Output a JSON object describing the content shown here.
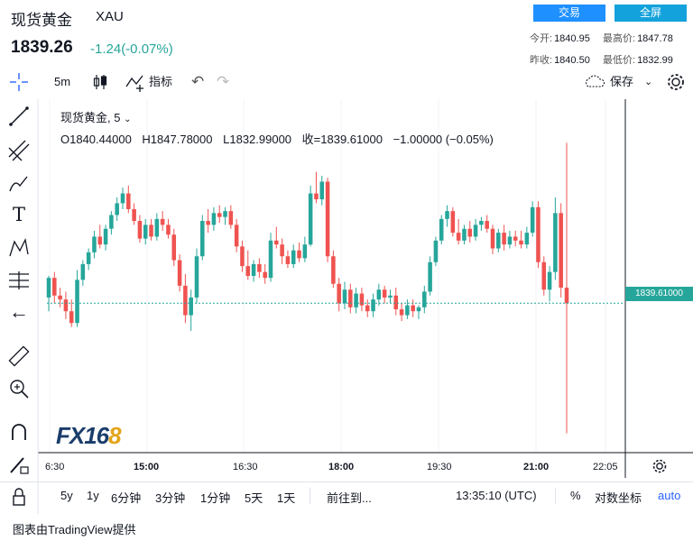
{
  "header": {
    "name": "现货黄金",
    "code": "XAU",
    "price": "1839.26",
    "change": "-1.24(-0.07%)",
    "buttons": {
      "trade": "交易",
      "fullscreen": "全屏"
    },
    "stats": {
      "open_label": "今开:",
      "open": "1840.95",
      "high_label": "最高价:",
      "high": "1847.78",
      "prev_label": "昨收:",
      "prev": "1840.50",
      "low_label": "最低价:",
      "low": "1832.99"
    }
  },
  "toolbar": {
    "interval": "5m",
    "indicators": "指标",
    "save": "保存"
  },
  "legend": {
    "title": "现货黄金, 5",
    "open": "O1840.44000",
    "high": "H1847.78000",
    "low": "L1832.99000",
    "close": "收=1839.61000",
    "change": "−1.00000 (−0.05%)"
  },
  "price_tag": "1839.61000",
  "watermark": "FX168",
  "time_axis": [
    "6:30",
    "15:00",
    "16:30",
    "18:00",
    "19:30",
    "21:00",
    "22:05"
  ],
  "bottom": {
    "ranges": [
      "5y",
      "1y",
      "6分钟",
      "3分钟",
      "1分钟",
      "5天",
      "1天"
    ],
    "goto": "前往到...",
    "clock": "13:35:10 (UTC)",
    "percent": "%",
    "log": "对数坐标",
    "auto": "auto"
  },
  "credit": "图表由TradingView提供",
  "colors": {
    "up": "#26a69a",
    "down": "#ef5350",
    "accent": "#1e90ff"
  },
  "chart_data": {
    "type": "candlestick",
    "y_last": 1839.61,
    "candles": [
      [
        1839.9,
        1841.0,
        1839.2,
        1840.9
      ],
      [
        1840.9,
        1841.2,
        1839.6,
        1840.0
      ],
      [
        1840.0,
        1840.4,
        1839.4,
        1839.8
      ],
      [
        1839.8,
        1840.2,
        1838.8,
        1839.2
      ],
      [
        1839.2,
        1839.8,
        1838.4,
        1838.6
      ],
      [
        1838.6,
        1841.3,
        1838.4,
        1840.8
      ],
      [
        1840.8,
        1841.8,
        1840.5,
        1841.6
      ],
      [
        1841.6,
        1842.4,
        1841.3,
        1842.2
      ],
      [
        1842.2,
        1843.3,
        1841.9,
        1843.0
      ],
      [
        1843.0,
        1843.6,
        1842.4,
        1842.6
      ],
      [
        1842.6,
        1843.6,
        1842.3,
        1843.4
      ],
      [
        1843.4,
        1844.3,
        1843.1,
        1844.1
      ],
      [
        1844.1,
        1845.0,
        1843.8,
        1844.7
      ],
      [
        1844.7,
        1845.5,
        1844.4,
        1845.2
      ],
      [
        1845.2,
        1845.6,
        1844.2,
        1844.4
      ],
      [
        1844.4,
        1844.7,
        1843.6,
        1843.8
      ],
      [
        1843.8,
        1844.1,
        1842.7,
        1842.9
      ],
      [
        1842.9,
        1843.9,
        1842.6,
        1843.6
      ],
      [
        1843.6,
        1843.9,
        1842.8,
        1843.0
      ],
      [
        1843.0,
        1844.2,
        1842.8,
        1843.9
      ],
      [
        1843.9,
        1844.3,
        1843.3,
        1843.6
      ],
      [
        1843.6,
        1843.9,
        1842.9,
        1843.1
      ],
      [
        1843.1,
        1843.4,
        1841.5,
        1841.8
      ],
      [
        1841.8,
        1842.1,
        1840.2,
        1840.5
      ],
      [
        1840.5,
        1841.1,
        1838.6,
        1839.0
      ],
      [
        1839.0,
        1840.3,
        1838.2,
        1839.9
      ],
      [
        1839.9,
        1842.4,
        1839.6,
        1842.0
      ],
      [
        1842.0,
        1844.1,
        1841.8,
        1843.8
      ],
      [
        1843.8,
        1844.4,
        1843.2,
        1843.6
      ],
      [
        1843.6,
        1844.5,
        1843.3,
        1844.2
      ],
      [
        1844.2,
        1844.6,
        1843.7,
        1844.0
      ],
      [
        1844.0,
        1844.5,
        1843.6,
        1844.3
      ],
      [
        1844.3,
        1844.6,
        1843.4,
        1843.6
      ],
      [
        1843.6,
        1843.9,
        1842.2,
        1842.5
      ],
      [
        1842.5,
        1842.8,
        1841.2,
        1841.5
      ],
      [
        1841.5,
        1842.3,
        1840.8,
        1841.0
      ],
      [
        1841.0,
        1841.8,
        1840.7,
        1841.6
      ],
      [
        1841.6,
        1841.9,
        1840.9,
        1841.2
      ],
      [
        1841.2,
        1841.6,
        1840.6,
        1840.9
      ],
      [
        1840.9,
        1843.2,
        1840.7,
        1842.8
      ],
      [
        1842.8,
        1843.5,
        1842.4,
        1842.6
      ],
      [
        1842.6,
        1842.9,
        1841.6,
        1842.0
      ],
      [
        1842.0,
        1842.3,
        1841.4,
        1841.6
      ],
      [
        1841.6,
        1842.6,
        1841.4,
        1842.3
      ],
      [
        1842.3,
        1842.7,
        1841.7,
        1841.9
      ],
      [
        1841.9,
        1843.0,
        1841.7,
        1842.6
      ],
      [
        1842.6,
        1845.6,
        1842.5,
        1845.2
      ],
      [
        1845.2,
        1846.3,
        1844.7,
        1844.9
      ],
      [
        1844.9,
        1846.1,
        1844.6,
        1845.8
      ],
      [
        1845.8,
        1846.0,
        1841.7,
        1842.0
      ],
      [
        1842.0,
        1842.3,
        1840.4,
        1840.6
      ],
      [
        1840.6,
        1840.9,
        1839.2,
        1839.6
      ],
      [
        1839.6,
        1840.7,
        1839.3,
        1840.3
      ],
      [
        1840.3,
        1840.6,
        1839.1,
        1839.4
      ],
      [
        1839.4,
        1840.4,
        1839.1,
        1840.1
      ],
      [
        1840.1,
        1840.4,
        1839.2,
        1839.5
      ],
      [
        1839.5,
        1839.8,
        1838.9,
        1839.2
      ],
      [
        1839.2,
        1840.1,
        1838.9,
        1839.8
      ],
      [
        1839.8,
        1840.6,
        1839.5,
        1840.3
      ],
      [
        1840.3,
        1840.5,
        1839.6,
        1839.9
      ],
      [
        1839.9,
        1840.3,
        1839.6,
        1840.0
      ],
      [
        1840.0,
        1840.4,
        1839.0,
        1839.3
      ],
      [
        1839.3,
        1839.6,
        1838.7,
        1839.0
      ],
      [
        1839.0,
        1839.8,
        1838.8,
        1839.5
      ],
      [
        1839.5,
        1839.8,
        1838.9,
        1839.2
      ],
      [
        1839.2,
        1839.5,
        1838.8,
        1839.4
      ],
      [
        1839.4,
        1840.5,
        1839.1,
        1840.2
      ],
      [
        1840.2,
        1842.0,
        1840.0,
        1841.7
      ],
      [
        1841.7,
        1843.0,
        1841.5,
        1842.8
      ],
      [
        1842.8,
        1844.1,
        1842.6,
        1843.9
      ],
      [
        1843.9,
        1844.6,
        1843.5,
        1844.3
      ],
      [
        1844.3,
        1844.5,
        1843.0,
        1843.2
      ],
      [
        1843.2,
        1843.9,
        1842.6,
        1842.8
      ],
      [
        1842.8,
        1843.6,
        1842.6,
        1843.4
      ],
      [
        1843.4,
        1843.8,
        1842.7,
        1843.0
      ],
      [
        1843.0,
        1843.9,
        1842.8,
        1843.6
      ],
      [
        1843.6,
        1844.0,
        1843.3,
        1843.8
      ],
      [
        1843.8,
        1844.1,
        1843.2,
        1843.4
      ],
      [
        1843.4,
        1843.6,
        1842.1,
        1842.4
      ],
      [
        1842.4,
        1843.4,
        1842.2,
        1843.2
      ],
      [
        1843.2,
        1843.6,
        1842.3,
        1842.6
      ],
      [
        1842.6,
        1843.3,
        1842.4,
        1843.0
      ],
      [
        1843.0,
        1843.3,
        1842.5,
        1842.8
      ],
      [
        1842.8,
        1843.3,
        1842.4,
        1842.6
      ],
      [
        1842.6,
        1843.5,
        1842.4,
        1843.2
      ],
      [
        1843.2,
        1844.8,
        1843.0,
        1844.5
      ],
      [
        1844.5,
        1844.8,
        1841.4,
        1841.7
      ],
      [
        1841.7,
        1842.0,
        1840.0,
        1840.3
      ],
      [
        1840.3,
        1841.5,
        1839.7,
        1841.2
      ],
      [
        1841.2,
        1845.0,
        1840.8,
        1844.2
      ],
      [
        1844.2,
        1844.7,
        1839.9,
        1840.4
      ],
      [
        1840.4,
        1847.78,
        1832.99,
        1839.61
      ]
    ]
  }
}
